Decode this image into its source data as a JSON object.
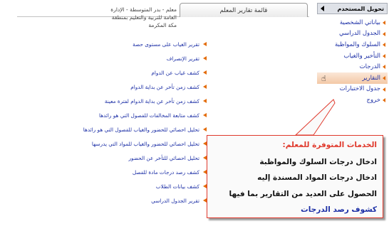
{
  "sidebar": {
    "header": "تحويل المستخدم",
    "items": [
      {
        "label": "بياناتي الشخصية"
      },
      {
        "label": "الجدول الدراسي"
      },
      {
        "label": "السلوك والمواظبة"
      },
      {
        "label": "التأخير والغياب"
      },
      {
        "label": "الدرجات"
      },
      {
        "label": "التقارير"
      },
      {
        "label": "جدول الاختبارات"
      },
      {
        "label": "خروج"
      }
    ]
  },
  "tab": {
    "label": "قائمة تقارير المعلم"
  },
  "breadcrumb": {
    "line1": "معلم - بدر المتوسطة - الإدارة العامة للتربية والتعليم بمنطقة",
    "line2": "مكة المكرمة"
  },
  "reports": [
    {
      "label": "تقرير الغياب على مستوى حصة"
    },
    {
      "label": "تقرير الإنصراف"
    },
    {
      "label": "كشف غياب عن الدوام"
    },
    {
      "label": "كشف زمن تأخر عن بداية الدوام"
    },
    {
      "label": "كشف زمن تأخر عن بداية الدوام لفترة معينة"
    },
    {
      "label": "كشف متابعة المخالفات للفصول التي هو رائدها"
    },
    {
      "label": "تحليل احصائي للحضور والغياب للفصول التي هو رائدها"
    },
    {
      "label": "تحليل احصائي للحضور والغياب للمواد التي يدرسها"
    },
    {
      "label": "تحليل احصائي للتأخر عن الحضور"
    },
    {
      "label": "كشف رصد درجات مادة للفصل"
    },
    {
      "label": "كشف بيانات الطلاب"
    },
    {
      "label": "تقرير الجدول الدراسي"
    }
  ],
  "callout": {
    "title": "الخدمات المتوفرة للمعلم:",
    "line1": "ادخال درجات السلوك والمواظبة",
    "line2": "ادخال درجات المواد المسندة إليه",
    "line3": "الحصول على العديد من التقارير بما فيها",
    "line4": "كشوف رصد الدرجات"
  },
  "colors": {
    "link": "#1c2fa6",
    "bullet": "#e36c0a",
    "callout_border": "#e0392c"
  }
}
